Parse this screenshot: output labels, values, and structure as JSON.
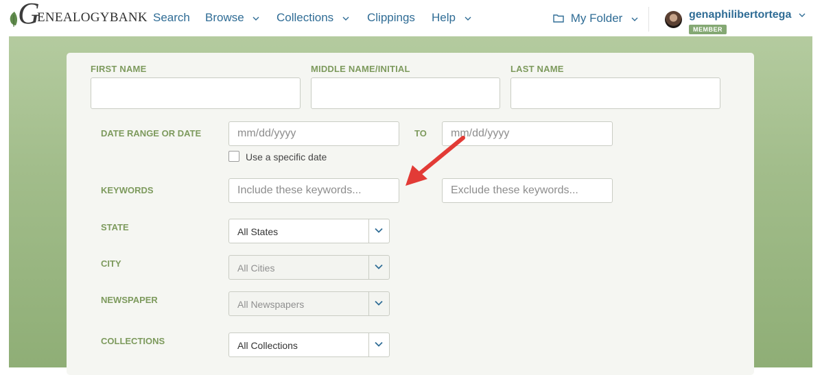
{
  "brand": {
    "logo_initial": "G",
    "logo_rest": "ENEALOGYBANK"
  },
  "nav": [
    {
      "label": "Search",
      "has_dropdown": false
    },
    {
      "label": "Browse",
      "has_dropdown": true
    },
    {
      "label": "Collections",
      "has_dropdown": true
    },
    {
      "label": "Clippings",
      "has_dropdown": false
    },
    {
      "label": "Help",
      "has_dropdown": true
    }
  ],
  "user": {
    "folder_label": "My Folder",
    "username": "genaphilibertortega",
    "badge": "MEMBER"
  },
  "form": {
    "first_name_label": "FIRST NAME",
    "middle_name_label": "MIDDLE NAME/INITIAL",
    "last_name_label": "LAST NAME",
    "first_name_value": "",
    "middle_name_value": "",
    "last_name_value": "",
    "date_label": "DATE RANGE OR DATE",
    "date_from_placeholder": "mm/dd/yyyy",
    "date_to_label": "TO",
    "date_to_placeholder": "mm/dd/yyyy",
    "specific_date_label": "Use a specific date",
    "specific_date_checked": false,
    "keywords_label": "KEYWORDS",
    "include_placeholder": "Include these keywords...",
    "exclude_placeholder": "Exclude these keywords...",
    "state_label": "STATE",
    "state_value": "All States",
    "city_label": "CITY",
    "city_value": "All Cities",
    "newspaper_label": "NEWSPAPER",
    "newspaper_value": "All Newspapers",
    "collections_label": "COLLECTIONS",
    "collections_value": "All Collections"
  },
  "colors": {
    "link_blue": "#2f6c95",
    "label_green": "#7d9a5d",
    "badge_green": "#84a873",
    "annotation_red": "#e23b36"
  },
  "icons": {
    "logo_leaf": "leaf-icon",
    "folder": "folder-icon",
    "dropdown": "chevron-down-icon",
    "annotation": "red-arrow-annotation"
  }
}
